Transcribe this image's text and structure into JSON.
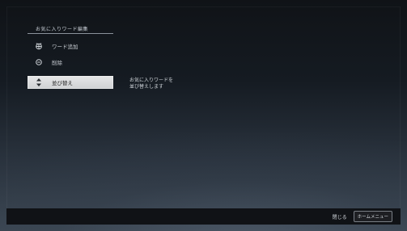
{
  "menu": {
    "title": "お気に入りワード編集",
    "items": [
      {
        "label": "ワード追加",
        "icon": "add-word-icon"
      },
      {
        "label": "削除",
        "icon": "delete-icon"
      },
      {
        "label": "並び替え",
        "icon": "sort-icon"
      }
    ],
    "selected_index": 2,
    "selected_description": "お気に入りワードを\n並び替えします"
  },
  "footer": {
    "label": "閉じる",
    "button": "ホームメニュー"
  }
}
